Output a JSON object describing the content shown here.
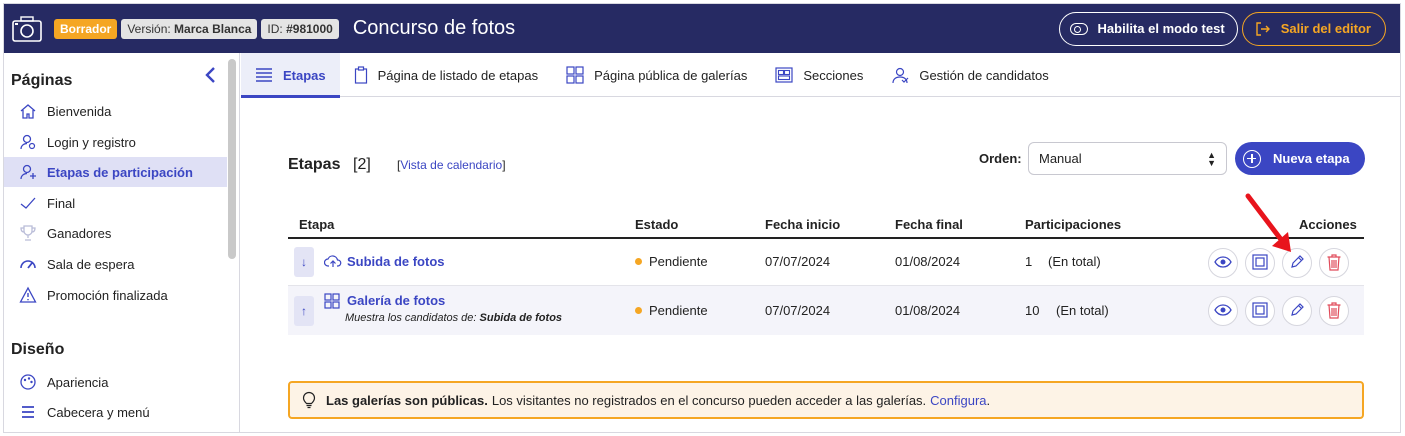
{
  "header": {
    "status_badge": "Borrador",
    "version_label": "Versión:",
    "version_value": "Marca Blanca",
    "id_label": "ID:",
    "id_value": "#981000",
    "title": "Concurso de fotos",
    "test_mode_button": "Habilita el modo test",
    "exit_button": "Salir del editor"
  },
  "sidebar": {
    "pages_heading": "Páginas",
    "pages": [
      {
        "label": "Bienvenida",
        "icon": "home-icon"
      },
      {
        "label": "Login y registro",
        "icon": "user-login-icon"
      },
      {
        "label": "Etapas de participación",
        "icon": "user-stages-icon",
        "active": true
      },
      {
        "label": "Final",
        "icon": "check-icon"
      },
      {
        "label": "Ganadores",
        "icon": "trophy-icon"
      },
      {
        "label": "Sala de espera",
        "icon": "gauge-icon"
      },
      {
        "label": "Promoción finalizada",
        "icon": "warning-icon"
      }
    ],
    "design_heading": "Diseño",
    "design": [
      {
        "label": "Apariencia",
        "icon": "palette-icon"
      },
      {
        "label": "Cabecera y menú",
        "icon": "menu-icon"
      }
    ]
  },
  "tabs": [
    {
      "label": "Etapas",
      "icon": "list-icon",
      "active": true
    },
    {
      "label": "Página de listado de etapas",
      "icon": "clipboard-icon"
    },
    {
      "label": "Página pública de galerías",
      "icon": "grid-icon"
    },
    {
      "label": "Secciones",
      "icon": "sections-icon"
    },
    {
      "label": "Gestión de candidatos",
      "icon": "candidates-icon"
    }
  ],
  "stages": {
    "title": "Etapas",
    "count": "[2]",
    "calendar_link_open": "[",
    "calendar_link": "Vista de calendario",
    "calendar_link_close": "]",
    "order_label": "Orden:",
    "order_value": "Manual",
    "new_button": "Nueva etapa",
    "columns": {
      "stage": "Etapa",
      "status": "Estado",
      "start": "Fecha inicio",
      "end": "Fecha final",
      "participations": "Participaciones",
      "actions": "Acciones"
    },
    "rows": [
      {
        "move": "↓",
        "icon": "cloud-upload-icon",
        "name": "Subida de fotos",
        "subtitle_prefix": "",
        "subtitle_value": "",
        "status": "Pendiente",
        "start": "07/07/2024",
        "end": "01/08/2024",
        "participations_count": "1",
        "participations_note": "(En total)"
      },
      {
        "move": "↑",
        "icon": "gallery-grid-icon",
        "name": "Galería de fotos",
        "subtitle_prefix": "Muestra los candidatos de:",
        "subtitle_value": "Subida de fotos",
        "status": "Pendiente",
        "start": "07/07/2024",
        "end": "01/08/2024",
        "participations_count": "10",
        "participations_note": "(En total)"
      }
    ],
    "action_icons": [
      "eye-icon",
      "duplicate-icon",
      "pencil-icon",
      "trash-icon"
    ]
  },
  "banner": {
    "bold": "Las galerías son públicas.",
    "text": "Los visitantes no registrados en el concurso pueden acceder a las galerías.",
    "link": "Configura",
    "trailing": "."
  },
  "colors": {
    "header_bg": "#262a63",
    "accent": "#3b46c3",
    "warning": "#f5a623",
    "danger": "#e04b5a",
    "annotation": "#e8141c"
  }
}
